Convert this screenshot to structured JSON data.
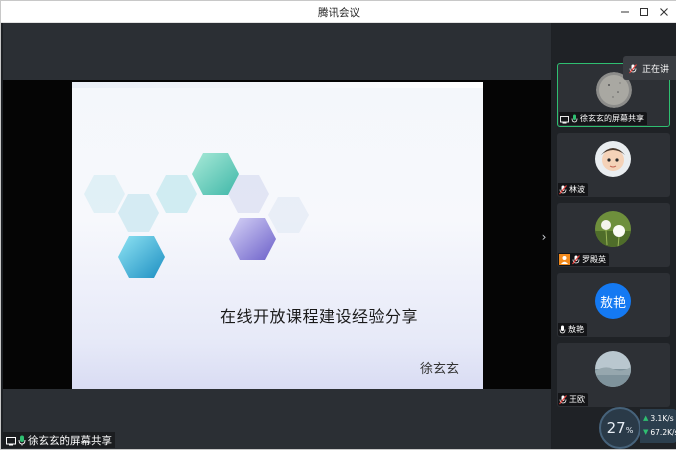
{
  "window": {
    "title": "腾讯会议",
    "controls": [
      "minimize-icon",
      "maximize-icon",
      "close-icon"
    ]
  },
  "share": {
    "presenter_label": "徐玄玄的屏幕共享",
    "slide": {
      "title": "在线开放课程建设经验分享",
      "author": "徐玄玄"
    },
    "collapse_icon": "chevron-right-icon"
  },
  "speaking": {
    "label": "正在讲"
  },
  "participants": [
    {
      "name": "徐玄玄的屏幕共享",
      "mic": "on",
      "icon": "screen-share-icon",
      "active": true
    },
    {
      "name": "林波",
      "mic": "muted"
    },
    {
      "name": "罗殿英",
      "mic": "muted",
      "icon": "user-icon"
    },
    {
      "name": "敖艳",
      "mic": "on",
      "avatar_text": "敖艳",
      "avatar_color": "#1479f2"
    },
    {
      "name": "王欧",
      "mic": "muted"
    }
  ],
  "network": {
    "cpu_percent": "27",
    "percent_sign": "%",
    "upload": "3.1",
    "upload_unit": "K/s",
    "download": "67.2",
    "download_unit": "K/s",
    "upload_color": "#2fbf71",
    "download_color": "#2fbf71"
  },
  "colors": {
    "active_border": "#2fbf71",
    "accent_blue": "#1479f2",
    "mic_on": "#2fbf71",
    "mic_muted": "#e8403c"
  }
}
